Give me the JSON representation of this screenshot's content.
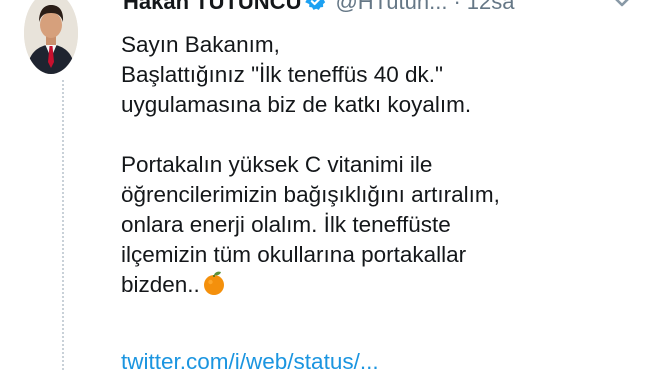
{
  "tweet": {
    "display_name": "Hakan TÜTÜNCÜ",
    "handle": "@HTutun...",
    "separator": "·",
    "time": "12sa",
    "lines_1": [
      "Sayın Bakanım,",
      "Başlattığınız \"İlk teneffüs 40 dk.\"",
      "uygulamasına biz de katkı koyalım."
    ],
    "lines_2": [
      "Portakalın yüksek C vitanimi ile",
      "öğrencilerimizin bağışıklığını artıralım,",
      "onlara enerji olalım. İlk teneffüste",
      "ilçemizin tüm okullarına portakallar"
    ],
    "last_line": "bizden..",
    "emoji": "orange-emoji",
    "link": "twitter.com/i/web/status/...",
    "icons": {
      "verified": "verified-badge-icon",
      "menu": "chevron-down-icon"
    },
    "colors": {
      "verified": "#1da1f2",
      "secondary_text": "#657786",
      "link": "#1b95e0",
      "orange": "#f4900c"
    }
  }
}
